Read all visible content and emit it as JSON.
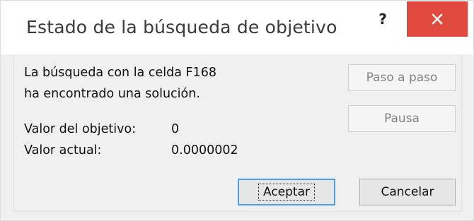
{
  "window": {
    "title": "Estado de la búsqueda de objetivo",
    "help_label": "?"
  },
  "message": {
    "line1": "La búsqueda con la celda F168",
    "line2": "ha encontrado una solución."
  },
  "values": {
    "target_label": "Valor del objetivo:",
    "target_value": "0",
    "current_label": "Valor actual:",
    "current_value": "0.0000002"
  },
  "buttons": {
    "step": "Paso a paso",
    "pause": "Pausa",
    "accept": "Aceptar",
    "cancel": "Cancelar"
  },
  "colors": {
    "close_button": "#e04a3e",
    "default_button_border": "#4f9ee0"
  }
}
